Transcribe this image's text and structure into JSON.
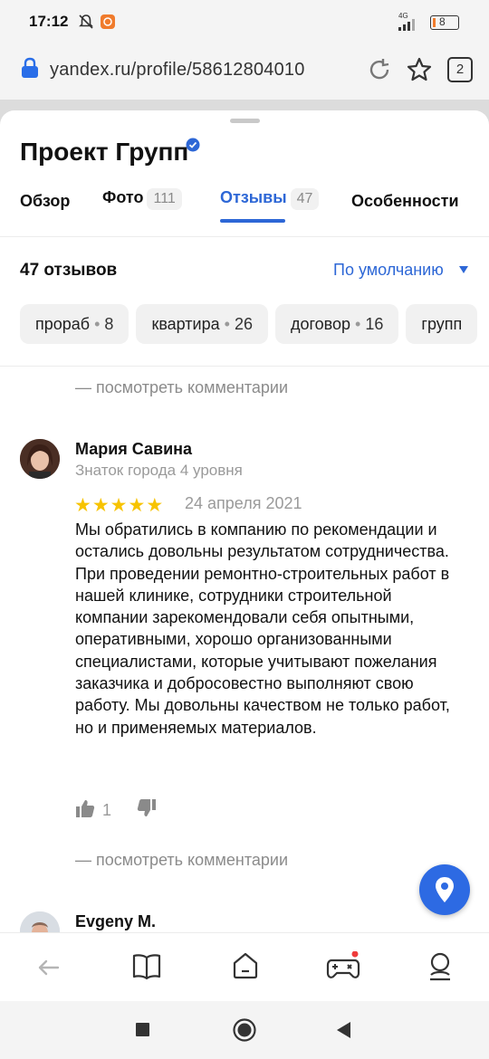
{
  "status_bar": {
    "time": "17:12",
    "network": "4G",
    "battery": "8"
  },
  "browser": {
    "url": "yandex.ru/profile/58612804010",
    "tabs_count": "2"
  },
  "org": {
    "name": "Проект Групп",
    "tabs": [
      {
        "label": "Обзор",
        "count": ""
      },
      {
        "label": "Фото",
        "count": "111"
      },
      {
        "label": "Отзывы",
        "count": "47"
      },
      {
        "label": "Особенности",
        "count": ""
      }
    ],
    "active_tab": "Отзывы"
  },
  "reviews_header": {
    "count_label": "47 отзывов",
    "sort_label": "По умолчанию"
  },
  "chips": [
    {
      "label": "прораб",
      "count": "8"
    },
    {
      "label": "квартира",
      "count": "26"
    },
    {
      "label": "договор",
      "count": "16"
    },
    {
      "label": "групп",
      "count": ""
    }
  ],
  "comments_link": "— посмотреть комментарии",
  "reviews": [
    {
      "author": "Мария Савина",
      "level": "Знаток города 4 уровня",
      "rating": 5,
      "date": "24 апреля 2021",
      "text": "Мы обратились в компанию по рекомендации и остались довольны результатом сотрудничества. При проведении ремонтно-строительных работ в нашей клинике, сотрудники строительной компании зарекомендовали себя опытными, оперативными, хорошо организованными специалистами, которые учитывают пожелания заказчика и добросовестно выполняют свою работу. Мы довольны качеством не только работ, но и применяемых материалов.",
      "likes": "1"
    },
    {
      "author": "Evgeny M."
    }
  ],
  "colors": {
    "accent": "#2d67d6",
    "star": "#f7c300",
    "fab": "#2d6ae3"
  },
  "icons": [
    "back-arrow-icon",
    "book-icon",
    "home-icon",
    "gamepad-icon",
    "profile-icon",
    "stop-icon",
    "home-circle-icon",
    "back-triangle-icon",
    "map-pin-icon",
    "thumbs-up-icon",
    "thumbs-down-icon",
    "lock-icon",
    "reload-icon",
    "star-icon",
    "verified-icon"
  ]
}
